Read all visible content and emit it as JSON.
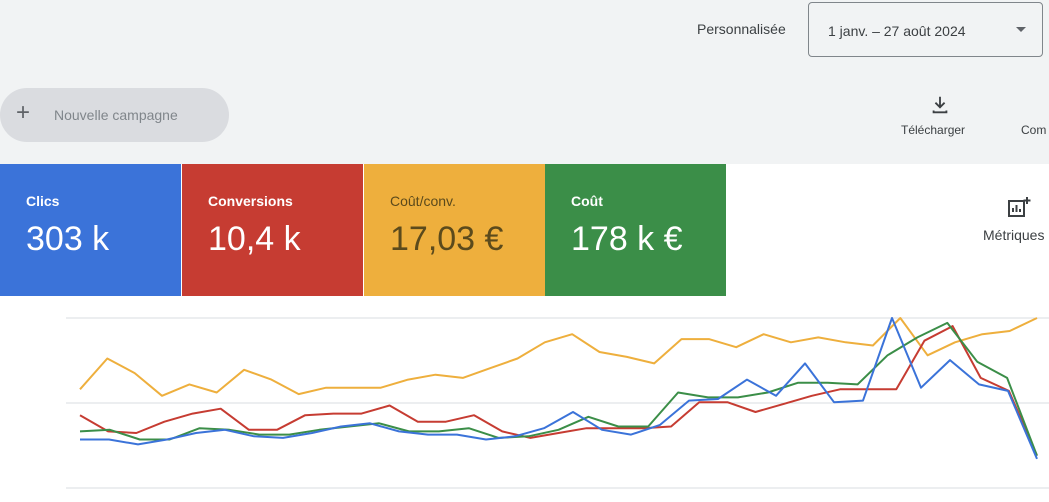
{
  "topbar": {
    "range_type": "Personnalisée",
    "date_range": "1 janv. – 27 août 2024"
  },
  "toolbar": {
    "new_campaign": "Nouvelle campagne",
    "download": "Télécharger",
    "columns_partial": "Com"
  },
  "scorecards": [
    {
      "title": "Clics",
      "value": "303 k",
      "color": "#3b73d9"
    },
    {
      "title": "Conversions",
      "value": "10,4 k",
      "color": "#c63c32"
    },
    {
      "title": "Coût/conv.",
      "value": "17,03 €",
      "color": "#eeaf3d"
    },
    {
      "title": "Coût",
      "value": "178 k €",
      "color": "#3b8e48"
    }
  ],
  "metrics_button": "Métriques",
  "icons": {
    "add": "plus-icon",
    "download": "download-icon",
    "metrics": "add-chart-icon",
    "dropdown": "caret-down-icon"
  },
  "chart_data": {
    "type": "line",
    "title": "",
    "xlabel": "",
    "ylabel": "",
    "grid": true,
    "ylim": [
      0,
      100
    ],
    "x": [
      1,
      2,
      3,
      4,
      5,
      6,
      7,
      8,
      9,
      10,
      11,
      12,
      13,
      14,
      15,
      16,
      17,
      18,
      19,
      20,
      21,
      22,
      23,
      24,
      25,
      26,
      27,
      28,
      29,
      30,
      31,
      32,
      33,
      34,
      35,
      36,
      37,
      38,
      39,
      40,
      41
    ],
    "series": [
      {
        "color": "#eeaf3d",
        "values": [
          56,
          75,
          66,
          52,
          59,
          54,
          68,
          62,
          53,
          57,
          57,
          57,
          62,
          65,
          63,
          69,
          75,
          85,
          90,
          79,
          76,
          72,
          87,
          87,
          82,
          90,
          85,
          88,
          85,
          83,
          100,
          77,
          85,
          90,
          92,
          100
        ]
      },
      {
        "color": "#c63c32",
        "values": [
          40,
          30,
          29,
          36,
          41,
          44,
          31,
          31,
          40,
          41,
          41,
          46,
          36,
          36,
          40,
          30,
          26,
          29,
          32,
          32,
          32,
          33,
          48,
          48,
          42,
          47,
          52,
          56,
          56,
          56,
          86,
          95,
          63,
          55,
          15
        ]
      },
      {
        "color": "#3b8e48",
        "values": [
          30,
          31,
          25,
          25,
          32,
          31,
          28,
          28,
          31,
          33,
          35,
          30,
          30,
          32,
          26,
          27,
          31,
          39,
          33,
          33,
          54,
          51,
          51,
          54,
          60,
          60,
          59,
          77,
          88,
          97,
          73,
          63,
          15
        ]
      },
      {
        "color": "#3b73d9",
        "values": [
          25,
          25,
          22,
          25,
          29,
          31,
          27,
          26,
          29,
          33,
          35,
          30,
          28,
          28,
          25,
          27,
          32,
          42,
          31,
          28,
          34,
          49,
          50,
          62,
          52,
          72,
          48,
          49,
          100,
          57,
          74,
          59,
          55,
          13
        ]
      }
    ]
  }
}
